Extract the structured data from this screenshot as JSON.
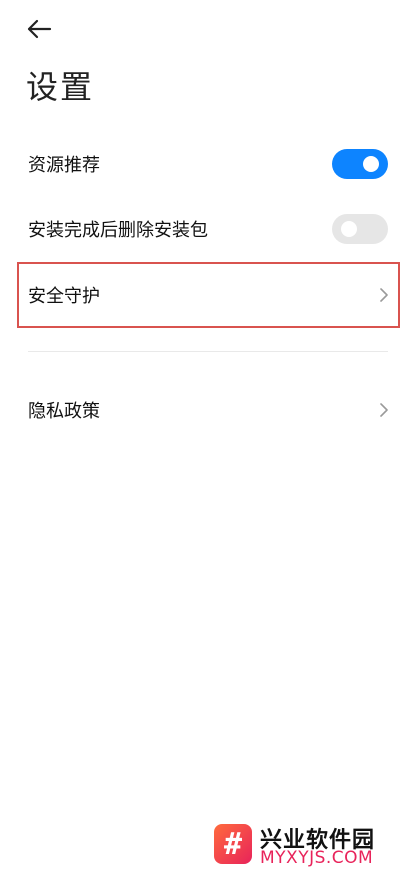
{
  "header": {
    "back_icon": "arrow-left-icon",
    "title": "设置"
  },
  "settings": {
    "resource_recommend": {
      "label": "资源推荐",
      "toggle_on": true
    },
    "delete_package": {
      "label": "安装完成后删除安装包",
      "toggle_on": false
    },
    "security_protection": {
      "label": "安全守护"
    },
    "privacy_policy": {
      "label": "隐私政策"
    }
  },
  "colors": {
    "accent": "#0d84ff",
    "toggle_off": "#e6e6e6",
    "highlight_border": "#d9534f"
  },
  "watermark": {
    "symbol": "#",
    "name_cn": "兴业软件园",
    "name_en": "MYXYJS.COM"
  }
}
